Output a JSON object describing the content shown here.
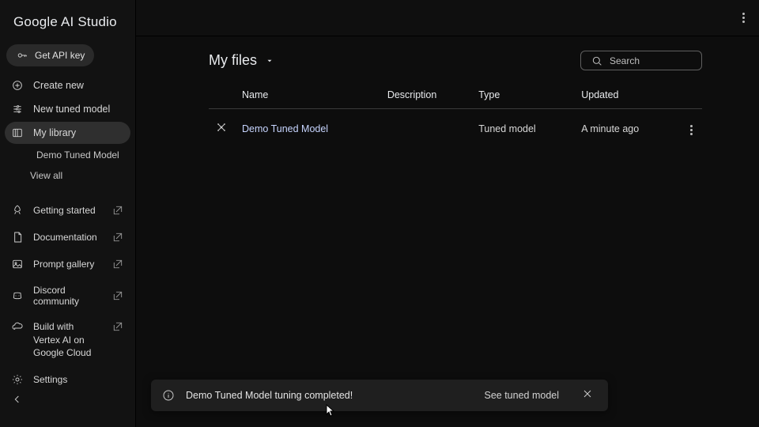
{
  "brand": "Google AI Studio",
  "api_key_label": "Get API key",
  "sidebar": {
    "items": [
      {
        "label": "Create new"
      },
      {
        "label": "New tuned model"
      },
      {
        "label": "My library"
      },
      {
        "label": "Demo Tuned Model"
      },
      {
        "label": "View all"
      }
    ],
    "links": [
      {
        "label": "Getting started"
      },
      {
        "label": "Documentation"
      },
      {
        "label": "Prompt gallery"
      },
      {
        "label": "Discord community"
      }
    ],
    "build": "Build with Vertex AI on Google Cloud",
    "settings": "Settings"
  },
  "page": {
    "title": "My files",
    "search_placeholder": "Search",
    "columns": {
      "c0": "",
      "c1": "Name",
      "c2": "Description",
      "c3": "Type",
      "c4": "Updated",
      "c5": ""
    },
    "rows": [
      {
        "name": "Demo Tuned Model",
        "description": "",
        "type": "Tuned model",
        "updated": "A minute ago"
      }
    ]
  },
  "toast": {
    "message": "Demo Tuned Model tuning completed!",
    "action": "See tuned model"
  }
}
